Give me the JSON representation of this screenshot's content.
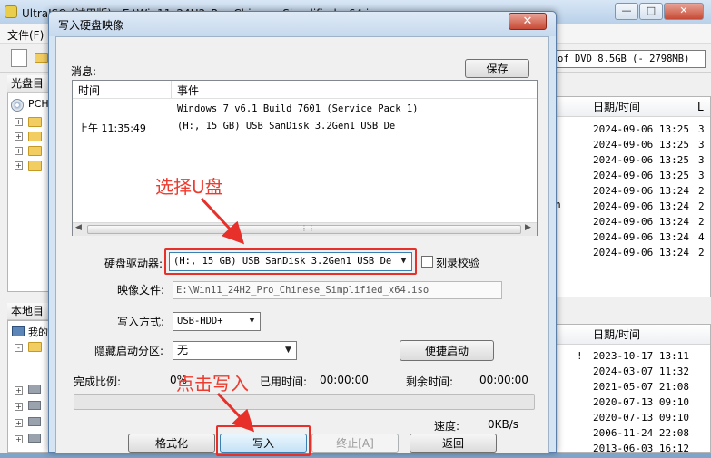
{
  "background_window": {
    "title": "UltraISO (试用版) - E:\\Win11_24H2_Pro_Chinese_Simplified_x64.iso",
    "menu_first": "文件(F)",
    "capacity_text": "of DVD 8.5GB (- 2798MB)",
    "panel_disc": "光盘目",
    "panel_local": "本地目",
    "disc_tree_root": "PCH",
    "local_tree_root": "我的",
    "upper_columns": {
      "date": "日期/时间",
      "extra": "L"
    },
    "upper_dates": [
      "2024-09-06 13:25",
      "2024-09-06 13:25",
      "2024-09-06 13:25",
      "2024-09-06 13:25",
      "2024-09-06 13:24",
      "2024-09-06 13:24",
      "2024-09-06 13:24",
      "2024-09-06 13:24",
      "2024-09-06 13:24"
    ],
    "upper_extra": [
      "3",
      "3",
      "3",
      "3",
      "2",
      "2",
      "2",
      "4",
      "2"
    ],
    "upper_stray": {
      "n": "n",
      "row": 5
    },
    "lower_columns": {
      "date": "日期/时间"
    },
    "lower_dates": [
      "2023-10-17 13:11",
      "2024-03-07 11:32",
      "2021-05-07 21:08",
      "2020-07-13 09:10",
      "2020-07-13 09:10",
      "2006-11-24 22:08",
      "2013-06-03 16:12"
    ],
    "lower_mark": "!"
  },
  "dialog": {
    "title": "写入硬盘映像",
    "close_glyph": "✕",
    "messages_label": "消息:",
    "save_button": "保存",
    "msg_columns": {
      "time": "时间",
      "event": "事件"
    },
    "messages": [
      {
        "time": "",
        "event": "Windows 7 v6.1 Build 7601 (Service Pack 1)"
      },
      {
        "time": "上午 11:35:49",
        "event": "(H:, 15 GB) USB  SanDisk 3.2Gen1 USB De"
      }
    ],
    "disk_drive_label": "硬盘驱动器:",
    "disk_drive_value": "(H:, 15 GB) USB  SanDisk 3.2Gen1 USB De",
    "verify_label": "刻录校验",
    "verify_checked": false,
    "image_file_label": "映像文件:",
    "image_file_value": "E:\\Win11_24H2_Pro_Chinese_Simplified_x64.iso",
    "write_mode_label": "写入方式:",
    "write_mode_value": "USB-HDD+",
    "hidden_partition_label": "隐藏启动分区:",
    "hidden_partition_value": "无",
    "quick_boot_button": "便捷启动",
    "completion_label": "完成比例:",
    "completion_value": "0%",
    "completion_fraction": 0,
    "elapsed_label": "已用时间:",
    "elapsed_value": "00:00:00",
    "remaining_label": "剩余时间:",
    "remaining_value": "00:00:00",
    "speed_label": "速度:",
    "speed_value": "0KB/s",
    "format_button": "格式化",
    "write_button": "写入",
    "stop_button": "终止[A]",
    "back_button": "返回"
  },
  "annotations": {
    "select_usb": "选择U盘",
    "click_write": "点击写入",
    "color": "#ee3b2f"
  }
}
